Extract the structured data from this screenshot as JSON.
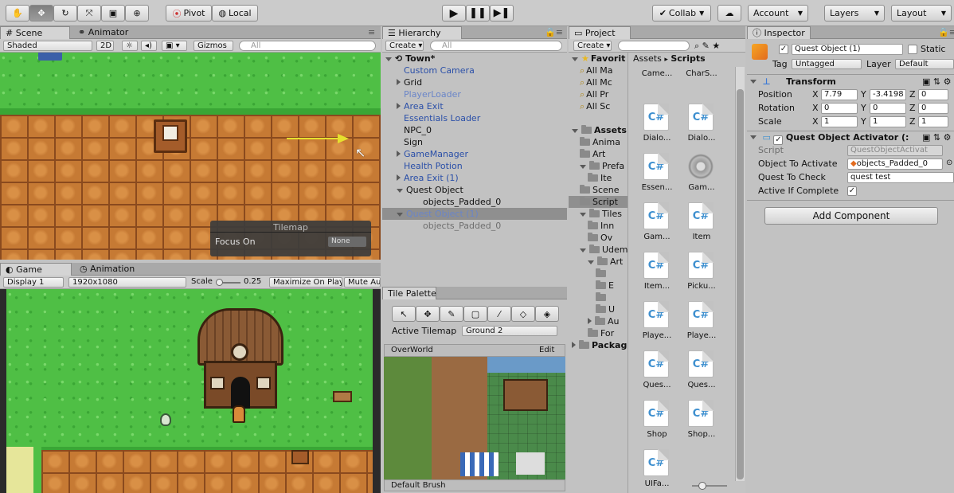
{
  "toolbar": {
    "pivot": "Pivot",
    "local": "Local",
    "collab": "Collab",
    "account": "Account",
    "layers": "Layers",
    "layout": "Layout"
  },
  "scene": {
    "tab_scene": "Scene",
    "tab_animator": "Animator",
    "shading": "Shaded",
    "mode_2d": "2D",
    "gizmos": "Gizmos",
    "search_placeholder": "All",
    "tilemap_title": "Tilemap",
    "focus_on_label": "Focus On",
    "focus_on_value": "None"
  },
  "game": {
    "tab_game": "Game",
    "tab_animation": "Animation",
    "display": "Display 1",
    "resolution": "1920x1080",
    "scale_label": "Scale",
    "scale_value": "0.25",
    "maximize": "Maximize On Play",
    "mute": "Mute Au"
  },
  "hierarchy": {
    "tab": "Hierarchy",
    "create": "Create",
    "search_placeholder": "All",
    "scene_name": "Town*",
    "items": [
      {
        "label": "Custom Camera",
        "style": "blue",
        "indent": 1,
        "arrow": ""
      },
      {
        "label": "Grid",
        "style": "",
        "indent": 1,
        "arrow": "right"
      },
      {
        "label": "PlayerLoader",
        "style": "lightblue",
        "indent": 1,
        "arrow": ""
      },
      {
        "label": "Area Exit",
        "style": "blue",
        "indent": 1,
        "arrow": "right"
      },
      {
        "label": "Essentials Loader",
        "style": "blue",
        "indent": 1,
        "arrow": ""
      },
      {
        "label": "NPC_0",
        "style": "",
        "indent": 1,
        "arrow": ""
      },
      {
        "label": "Sign",
        "style": "",
        "indent": 1,
        "arrow": ""
      },
      {
        "label": "GameManager",
        "style": "blue",
        "indent": 1,
        "arrow": "right"
      },
      {
        "label": "Health Potion",
        "style": "blue",
        "indent": 1,
        "arrow": ""
      },
      {
        "label": "Area Exit (1)",
        "style": "blue",
        "indent": 1,
        "arrow": "right"
      },
      {
        "label": "Quest Object",
        "style": "",
        "indent": 1,
        "arrow": "down"
      },
      {
        "label": "objects_Padded_0",
        "style": "",
        "indent": 2,
        "arrow": ""
      },
      {
        "label": "Quest Object (1)",
        "style": "lightblue",
        "indent": 1,
        "arrow": "down",
        "selected": true
      },
      {
        "label": "objects_Padded_0",
        "style": "grey",
        "indent": 2,
        "arrow": ""
      }
    ]
  },
  "tile_palette": {
    "tab": "Tile Palette",
    "active_tilemap_label": "Active Tilemap",
    "active_tilemap_value": "Ground 2",
    "palette": "OverWorld",
    "edit": "Edit",
    "brush": "Default Brush"
  },
  "project": {
    "tab": "Project",
    "create": "Create",
    "breadcrumb_root": "Assets",
    "breadcrumb_current": "Scripts",
    "tree": [
      {
        "label": "Favorit",
        "bold": true,
        "arrow": "down",
        "icon": "star",
        "indent": 0
      },
      {
        "label": "All Ma",
        "bold": false,
        "arrow": "",
        "icon": "search",
        "indent": 1
      },
      {
        "label": "All Mc",
        "bold": false,
        "arrow": "",
        "icon": "search",
        "indent": 1
      },
      {
        "label": "All Pr",
        "bold": false,
        "arrow": "",
        "icon": "search",
        "indent": 1
      },
      {
        "label": "All Sc",
        "bold": false,
        "arrow": "",
        "icon": "search",
        "indent": 1
      },
      {
        "label": "",
        "bold": false,
        "arrow": "",
        "icon": "",
        "indent": 0
      },
      {
        "label": "Assets",
        "bold": true,
        "arrow": "down",
        "icon": "folder",
        "indent": 0
      },
      {
        "label": "Anima",
        "bold": false,
        "arrow": "",
        "icon": "folder",
        "indent": 1
      },
      {
        "label": "Art",
        "bold": false,
        "arrow": "",
        "icon": "folder",
        "indent": 1
      },
      {
        "label": "Prefa",
        "bold": false,
        "arrow": "down",
        "icon": "folder",
        "indent": 1
      },
      {
        "label": "Ite",
        "bold": false,
        "arrow": "",
        "icon": "folder",
        "indent": 2
      },
      {
        "label": "Scene",
        "bold": false,
        "arrow": "",
        "icon": "folder",
        "indent": 1
      },
      {
        "label": "Script",
        "bold": false,
        "arrow": "",
        "icon": "folder",
        "indent": 1,
        "selected": true
      },
      {
        "label": "Tiles",
        "bold": false,
        "arrow": "down",
        "icon": "folder",
        "indent": 1
      },
      {
        "label": "Inn",
        "bold": false,
        "arrow": "",
        "icon": "folder",
        "indent": 2
      },
      {
        "label": "Ov",
        "bold": false,
        "arrow": "",
        "icon": "folder",
        "indent": 2
      },
      {
        "label": "Udem",
        "bold": false,
        "arrow": "down",
        "icon": "folder",
        "indent": 1
      },
      {
        "label": "Art",
        "bold": false,
        "arrow": "down",
        "icon": "folder",
        "indent": 2
      },
      {
        "label": "",
        "bold": false,
        "arrow": "",
        "icon": "folder",
        "indent": 3
      },
      {
        "label": "E",
        "bold": false,
        "arrow": "",
        "icon": "folder",
        "indent": 3
      },
      {
        "label": "",
        "bold": false,
        "arrow": "",
        "icon": "folder",
        "indent": 3
      },
      {
        "label": "U",
        "bold": false,
        "arrow": "",
        "icon": "folder",
        "indent": 3
      },
      {
        "label": "Au",
        "bold": false,
        "arrow": "right",
        "icon": "folder",
        "indent": 2
      },
      {
        "label": "For",
        "bold": false,
        "arrow": "",
        "icon": "folder",
        "indent": 2
      },
      {
        "label": "Packag",
        "bold": true,
        "arrow": "right",
        "icon": "folder",
        "indent": 0
      }
    ],
    "scripts": [
      {
        "label": "Came...",
        "icon": "cs"
      },
      {
        "label": "CharS...",
        "icon": "cs"
      },
      {
        "label": "Dialo...",
        "icon": "cs"
      },
      {
        "label": "Dialo...",
        "icon": "cs"
      },
      {
        "label": "Essen...",
        "icon": "cs"
      },
      {
        "label": "Gam...",
        "icon": "gear"
      },
      {
        "label": "Gam...",
        "icon": "cs"
      },
      {
        "label": "Item",
        "icon": "cs"
      },
      {
        "label": "Item...",
        "icon": "cs"
      },
      {
        "label": "Picku...",
        "icon": "cs"
      },
      {
        "label": "Playe...",
        "icon": "cs"
      },
      {
        "label": "Playe...",
        "icon": "cs"
      },
      {
        "label": "Ques...",
        "icon": "cs"
      },
      {
        "label": "Ques...",
        "icon": "cs"
      },
      {
        "label": "Shop",
        "icon": "cs"
      },
      {
        "label": "Shop...",
        "icon": "cs"
      },
      {
        "label": "UIFa...",
        "icon": "cs"
      }
    ]
  },
  "inspector": {
    "tab": "Inspector",
    "object_name": "Quest Object (1)",
    "static_label": "Static",
    "tag_label": "Tag",
    "tag_value": "Untagged",
    "layer_label": "Layer",
    "layer_value": "Default",
    "transform": {
      "title": "Transform",
      "position_label": "Position",
      "rotation_label": "Rotation",
      "scale_label": "Scale",
      "position": {
        "x": "7.79",
        "y": "-3.4198",
        "z": "0"
      },
      "rotation": {
        "x": "0",
        "y": "0",
        "z": "0"
      },
      "scale": {
        "x": "1",
        "y": "1",
        "z": "1"
      }
    },
    "component": {
      "title": "Quest Object Activator (:",
      "script_label": "Script",
      "script_value": "QuestObjectActivat",
      "object_label": "Object To Activate",
      "object_value": "objects_Padded_0",
      "quest_label": "Quest To Check",
      "quest_value": "quest test",
      "active_label": "Active If Complete"
    },
    "add_component": "Add Component"
  },
  "axis": {
    "x": "X",
    "y": "Y",
    "z": "Z"
  },
  "colors": {
    "accent_blue": "#2a4fa8",
    "grass": "#4fbf45",
    "dirt": "#c67a34",
    "csharp": "#3d8fcf"
  }
}
